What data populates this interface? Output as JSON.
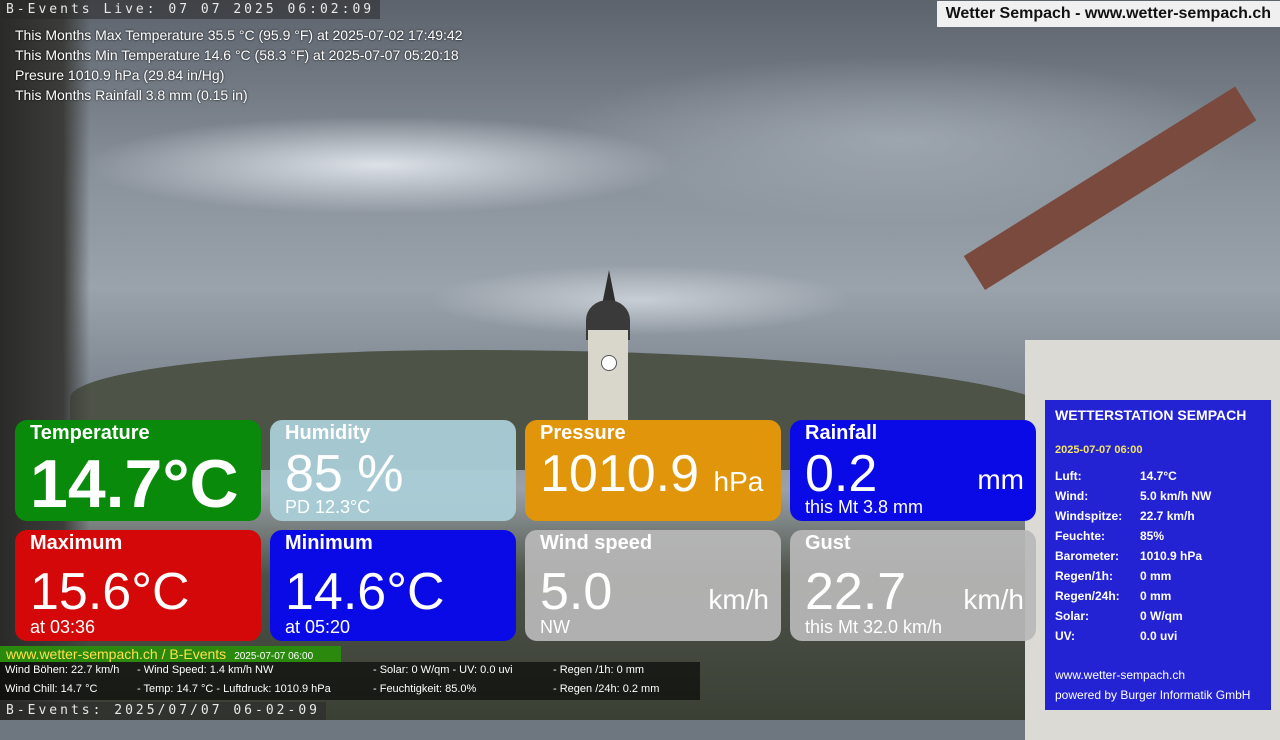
{
  "webcam": {
    "top_overlay": "B-Events Live: 07 07 2025 06:02:09",
    "bottom_overlay": "B-Events: 2025/07/07 06-02-09"
  },
  "site_title": "Wetter Sempach - www.wetter-sempach.ch",
  "info_lines": [
    "This Months Max Temperature 35.5 °C (95.9 °F) at 2025-07-02 17:49:42",
    "This Months Min Temperature 14.6 °C (58.3 °F) at 2025-07-07 05:20:18",
    "Presure 1010.9 hPa (29.84 in/Hg)",
    "This Months Rainfall 3.8 mm (0.15 in)"
  ],
  "tiles": {
    "temperature": {
      "title": "Temperature",
      "value": "14.7°C",
      "color": "#0a8a0a"
    },
    "humidity": {
      "title": "Humidity",
      "value": "85 %",
      "sub": "PD 12.3°C",
      "color": "#aacdd7"
    },
    "pressure": {
      "title": "Pressure",
      "value": "1010.9",
      "unit": "hPa",
      "color": "#e0950a"
    },
    "rainfall": {
      "title": "Rainfall",
      "value": "0.2",
      "unit": "mm",
      "sub": "this Mt 3.8 mm",
      "color": "#0a0ae6"
    },
    "maximum": {
      "title": "Maximum",
      "value": "15.6°C",
      "sub": "at 03:36",
      "color": "#d40808"
    },
    "minimum": {
      "title": "Minimum",
      "value": "14.6°C",
      "sub": "at 05:20",
      "color": "#0a0ae6"
    },
    "wind_speed": {
      "title": "Wind speed",
      "value": "5.0",
      "unit": "km/h",
      "sub": "NW",
      "color": "#b9b9b9"
    },
    "gust": {
      "title": "Gust",
      "value": "22.7",
      "unit": "km/h",
      "sub": "this Mt 32.0 km/h",
      "color": "#b9b9b9"
    }
  },
  "station": {
    "title": "WETTERSTATION SEMPACH",
    "datetime": "2025-07-07 06:00",
    "rows": [
      {
        "key": "Luft:",
        "value": "14.7°C"
      },
      {
        "key": "Wind:",
        "value": "5.0 km/h  NW"
      },
      {
        "key": "Windspitze:",
        "value": "22.7 km/h"
      },
      {
        "key": "Feuchte:",
        "value": "85%"
      },
      {
        "key": "Barometer:",
        "value": "1010.9 hPa"
      },
      {
        "key": "Regen/1h:",
        "value": "0 mm"
      },
      {
        "key": "Regen/24h:",
        "value": "0 mm"
      },
      {
        "key": "Solar:",
        "value": "0 W/qm"
      },
      {
        "key": "UV:",
        "value": "0.0 uvi"
      }
    ],
    "site": "www.wetter-sempach.ch",
    "credit": "powered by Burger Informatik GmbH"
  },
  "bottom_banner": {
    "site": "www.wetter-sempach.ch / B-Events",
    "datetime": "2025-07-07 06:00"
  },
  "bottom_info": {
    "wind_gusts": "Wind Böhen: 22.7 km/h",
    "wind_speed": "- Wind Speed: 1.4 km/h NW",
    "solar_uv": "- Solar: 0 W/qm   - UV: 0.0 uvi",
    "rain_1h": "- Regen /1h:   0 mm",
    "wind_chill": "Wind Chill: 14.7 °C",
    "temp_pressure": "- Temp: 14.7 °C  - Luftdruck: 1010.9 hPa",
    "humidity": "- Feuchtigkeit: 85.0%",
    "rain_24h": "- Regen /24h: 0.2 mm"
  }
}
